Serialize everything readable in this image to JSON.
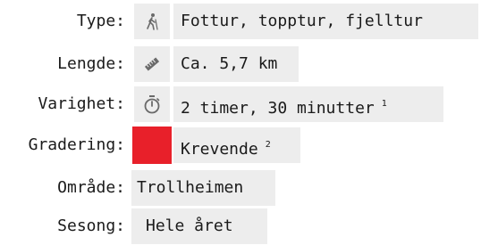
{
  "rows": {
    "type": {
      "label": "Type:",
      "icon": "hiker-icon",
      "value": "Fottur, topptur, fjelltur"
    },
    "length": {
      "label": "Lengde:",
      "icon": "ruler-icon",
      "value": "Ca. 5,7 km"
    },
    "duration": {
      "label": "Varighet:",
      "icon": "stopwatch-icon",
      "value": "2 timer, 30 minutter",
      "footnote": "1"
    },
    "grade": {
      "label": "Gradering:",
      "color": "#e8202a",
      "value": "Krevende",
      "footnote": "2"
    },
    "area": {
      "label": "Område:",
      "value": "Trollheimen"
    },
    "season": {
      "label": "Sesong:",
      "value": "Hele året"
    }
  }
}
